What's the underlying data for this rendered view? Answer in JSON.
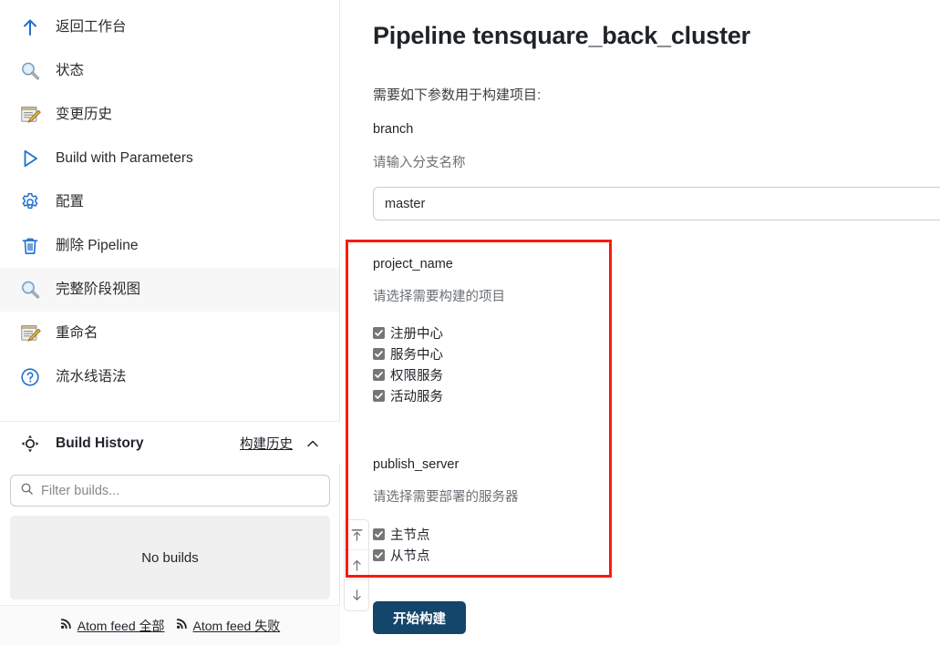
{
  "sidebar": {
    "items": [
      {
        "label": "返回工作台",
        "icon": "up-arrow-icon",
        "name": "back-to-dashboard",
        "active": false
      },
      {
        "label": "状态",
        "icon": "magnifier-icon",
        "name": "status",
        "active": false
      },
      {
        "label": "变更历史",
        "icon": "notepad-pencil-icon",
        "name": "change-history",
        "active": false
      },
      {
        "label": "Build with Parameters",
        "icon": "play-icon",
        "name": "build-with-parameters",
        "active": false
      },
      {
        "label": "配置",
        "icon": "gear-icon",
        "name": "configure",
        "active": false
      },
      {
        "label": "删除 Pipeline",
        "icon": "trash-icon",
        "name": "delete-pipeline",
        "active": false
      },
      {
        "label": "完整阶段视图",
        "icon": "magnifier-icon",
        "name": "full-stage-view",
        "active": true
      },
      {
        "label": "重命名",
        "icon": "notepad-pencil-icon",
        "name": "rename",
        "active": false
      },
      {
        "label": "流水线语法",
        "icon": "help-circle-icon",
        "name": "pipeline-syntax",
        "active": false
      }
    ],
    "build_history": {
      "title": "Build History",
      "link_label": "构建历史",
      "collapse_icon": "chevron-up-icon",
      "icon": "build-history-icon",
      "filter_placeholder": "Filter builds...",
      "filter_value": "",
      "search_icon": "search-icon",
      "empty_label": "No builds"
    },
    "feeds": [
      {
        "label": "Atom feed 全部",
        "icon": "rss-icon",
        "name": "atom-feed-all"
      },
      {
        "label": "Atom feed 失败",
        "icon": "rss-icon",
        "name": "atom-feed-failed"
      }
    ]
  },
  "main": {
    "title": "Pipeline tensquare_back_cluster",
    "intro": "需要如下参数用于构建项目:",
    "params": [
      {
        "name": "branch",
        "description": "请输入分支名称",
        "type": "text",
        "value": "master",
        "placeholder": ""
      },
      {
        "name": "project_name",
        "description": "请选择需要构建的项目",
        "type": "checkbox-group",
        "options": [
          {
            "label": "注册中心",
            "checked": true
          },
          {
            "label": "服务中心",
            "checked": true
          },
          {
            "label": "权限服务",
            "checked": true
          },
          {
            "label": "活动服务",
            "checked": true
          }
        ]
      },
      {
        "name": "publish_server",
        "description": "请选择需要部署的服务器",
        "type": "checkbox-group",
        "options": [
          {
            "label": "主节点",
            "checked": true
          },
          {
            "label": "从节点",
            "checked": true
          }
        ]
      }
    ],
    "submit_label": "开始构建"
  },
  "scroll_nub": {
    "buttons": [
      {
        "name": "scroll-to-top-button",
        "icon": "arrow-to-top-icon"
      },
      {
        "name": "scroll-up-button",
        "icon": "arrow-up-icon"
      },
      {
        "name": "scroll-down-button",
        "icon": "arrow-down-icon"
      }
    ]
  },
  "annotation": {
    "type": "rectangle-highlight",
    "color": "#f91a11"
  },
  "colors": {
    "accent_blue": "#1f6fd0",
    "button_navy": "#14456b",
    "annotation_red": "#f91a11",
    "checkbox_gray": "#767676",
    "active_row": "#f7f7f8"
  }
}
